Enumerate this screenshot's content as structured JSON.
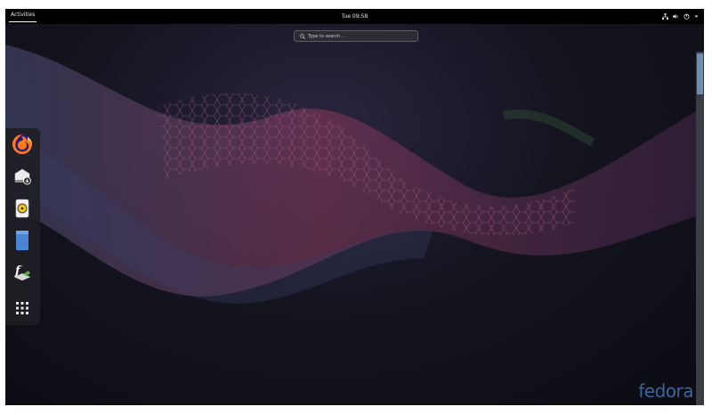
{
  "topbar": {
    "activities_label": "Activities",
    "clock": "Tue 09:58"
  },
  "search": {
    "placeholder": "Type to search..."
  },
  "dash": {
    "items": [
      {
        "name": "firefox",
        "icon": "firefox-icon"
      },
      {
        "name": "software",
        "icon": "software-store-icon"
      },
      {
        "name": "rhythmbox",
        "icon": "music-player-icon"
      },
      {
        "name": "files",
        "icon": "files-icon"
      },
      {
        "name": "fedora-media-writer",
        "icon": "fedora-media-writer-icon"
      },
      {
        "name": "show-applications",
        "icon": "app-grid-icon"
      }
    ]
  },
  "tray": [
    "network-icon",
    "volume-icon",
    "power-icon",
    "dropdown-arrow-icon"
  ],
  "brand": {
    "logo_text": "fedora",
    "colors": {
      "logo": "#3d76b8",
      "topbar": "#000000",
      "dash": "#1e1f26"
    }
  }
}
